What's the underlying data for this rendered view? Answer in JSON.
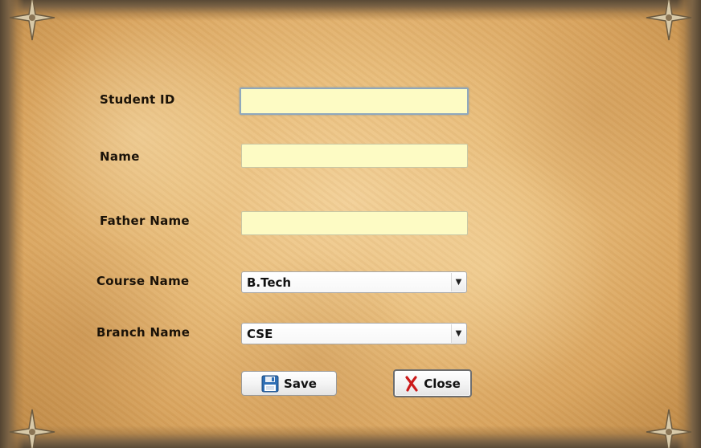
{
  "form": {
    "labels": {
      "student_id": "Student ID",
      "name": "Name",
      "father_name": "Father Name",
      "course_name": "Course Name",
      "branch_name": "Branch Name"
    },
    "fields": {
      "student_id": "",
      "name": "",
      "father_name": ""
    },
    "course": {
      "selected": "B.Tech"
    },
    "branch": {
      "selected": "CSE"
    },
    "buttons": {
      "save": {
        "label": "Save",
        "icon": "floppy-disk-icon"
      },
      "close": {
        "label": "Close",
        "icon": "red-x-icon"
      }
    }
  },
  "decor": {
    "corner_icon": "compass-star-icon"
  },
  "colors": {
    "input_background": "#fdfbc4",
    "label_text": "#1a1208",
    "close_icon_red": "#cc1a1a"
  }
}
